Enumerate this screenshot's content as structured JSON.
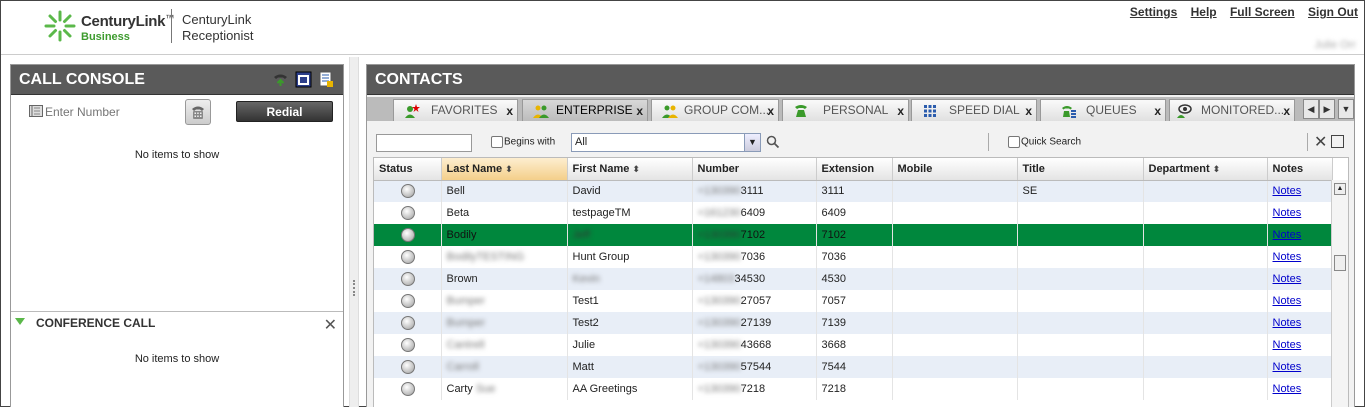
{
  "header": {
    "brand_main": "CenturyLink",
    "brand_tm": "™",
    "brand_sub": "Business",
    "product_line1": "CenturyLink",
    "product_line2": "Receptionist",
    "links": [
      "Settings",
      "Help",
      "Full Screen",
      "Sign Out"
    ],
    "username": "Julie Orr"
  },
  "call_console": {
    "title": "CALL CONSOLE",
    "number_placeholder": "Enter Number",
    "redial_label": "Redial",
    "empty_text": "No items to show"
  },
  "conference": {
    "title": "CONFERENCE CALL",
    "empty_text": "No items to show"
  },
  "contacts": {
    "title": "CONTACTS",
    "tabs": [
      {
        "label": "FAVORITES",
        "icon": "favorites-icon"
      },
      {
        "label": "ENTERPRISE",
        "icon": "enterprise-icon",
        "active": true
      },
      {
        "label": "GROUP COM...",
        "icon": "group-icon"
      },
      {
        "label": "PERSONAL",
        "icon": "personal-icon"
      },
      {
        "label": "SPEED DIAL",
        "icon": "speed-dial-icon"
      },
      {
        "label": "QUEUES",
        "icon": "queues-icon"
      },
      {
        "label": "MONITORED...",
        "icon": "monitored-icon"
      }
    ],
    "tab_close": "x",
    "filter": {
      "begins_with_label": "Begins with",
      "scope_value": "All",
      "quick_search_label": "Quick Search"
    },
    "columns": [
      "Status",
      "Last Name",
      "First Name",
      "Number",
      "Extension",
      "Mobile",
      "Title",
      "Department",
      "Notes"
    ],
    "rows": [
      {
        "last": "Bell",
        "first": "David",
        "number_hidden": "+130390",
        "number": "3111",
        "ext": "3111",
        "mobile": "",
        "title": "SE",
        "dept": "",
        "notes": "Notes"
      },
      {
        "last": "Beta",
        "first": "testpageTM",
        "number_hidden": "+161230",
        "number": "6409",
        "ext": "6409",
        "mobile": "",
        "title": "",
        "dept": "",
        "notes": "Notes"
      },
      {
        "last": "Bodily",
        "first_hidden": "Jeff",
        "first": "",
        "number_hidden": "+130390",
        "number": "7102",
        "ext": "7102",
        "mobile": "",
        "title": "",
        "dept": "",
        "notes": "Notes",
        "selected": true
      },
      {
        "last_hidden": "BodilyTESTING",
        "last": "",
        "first": "Hunt Group",
        "number_hidden": "+130390",
        "number": "7036",
        "ext": "7036",
        "mobile": "",
        "title": "",
        "dept": "",
        "notes": "Notes"
      },
      {
        "last": "Brown",
        "first_hidden": "Kevin",
        "first": "",
        "number_hidden": "+14803",
        "number": "34530",
        "ext": "4530",
        "mobile": "",
        "title": "",
        "dept": "",
        "notes": "Notes"
      },
      {
        "last_hidden": "Bumper",
        "last": "",
        "first": "Test1",
        "number_hidden": "+130390",
        "number": "27057",
        "ext": "7057",
        "mobile": "",
        "title": "",
        "dept": "",
        "notes": "Notes"
      },
      {
        "last_hidden": "Bumper",
        "last": "",
        "first": "Test2",
        "number_hidden": "+130390",
        "number": "27139",
        "ext": "7139",
        "mobile": "",
        "title": "",
        "dept": "",
        "notes": "Notes"
      },
      {
        "last_hidden": "Cantrell",
        "last": "",
        "first": "Julie",
        "number_hidden": "+130390",
        "number": "43668",
        "ext": "3668",
        "mobile": "",
        "title": "",
        "dept": "",
        "notes": "Notes"
      },
      {
        "last_hidden": "Carroll",
        "last": "",
        "first": "Matt",
        "number_hidden": "+130390",
        "number": "57544",
        "ext": "7544",
        "mobile": "",
        "title": "",
        "dept": "",
        "notes": "Notes"
      },
      {
        "last": "Carty",
        "last_hidden": "Sue",
        "first": "AA Greetings",
        "number_hidden": "+130390",
        "number": "7218",
        "ext": "7218",
        "mobile": "",
        "title": "",
        "dept": "",
        "notes": "Notes"
      }
    ]
  },
  "colors": {
    "brand_green": "#3d9b2e",
    "panel_header": "#5a5a5a",
    "selected_row": "#00873d",
    "alt_row": "#e8eef7"
  }
}
